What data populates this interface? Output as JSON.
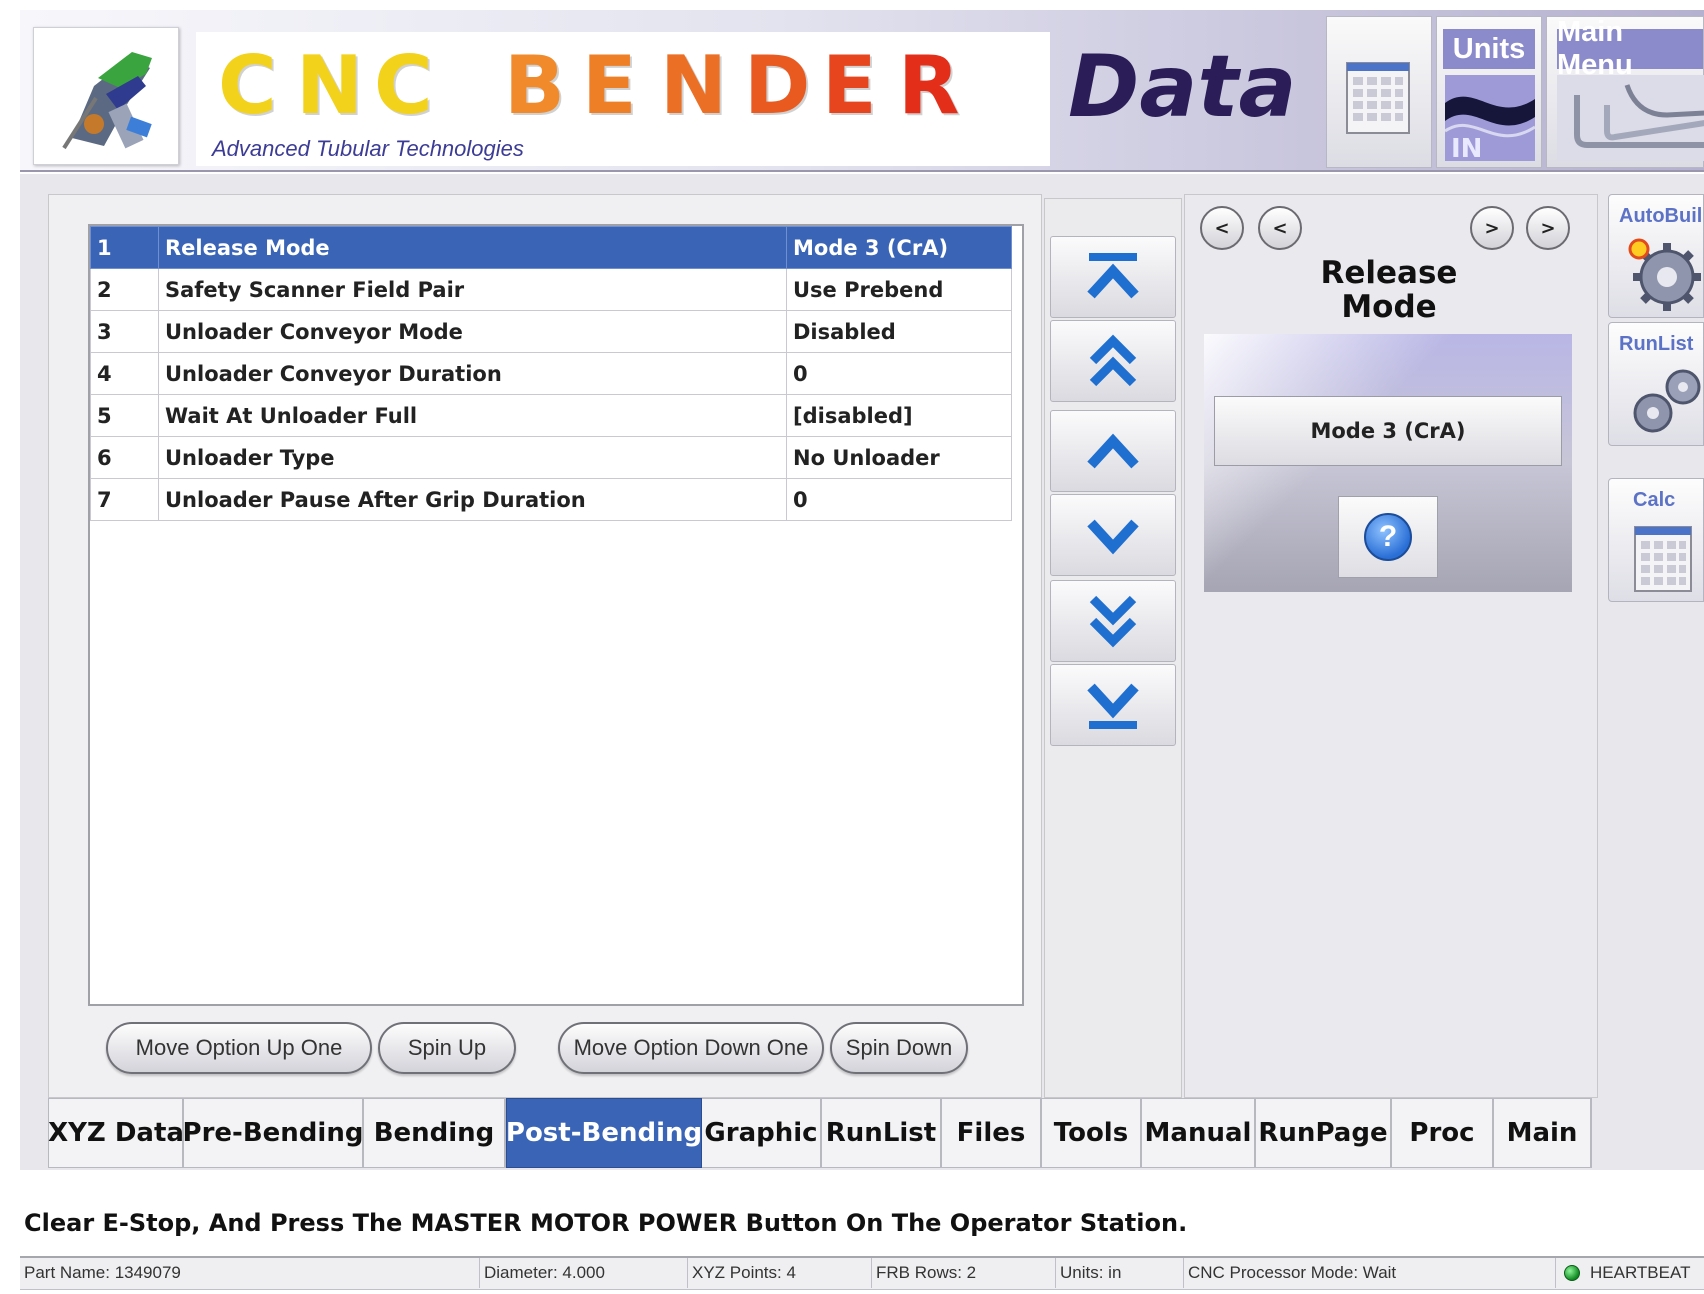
{
  "header": {
    "title_letters": [
      {
        "char": "C",
        "color": "#f2d21a"
      },
      {
        "char": "N",
        "color": "#f2d21a"
      },
      {
        "char": "C",
        "color": "#f2d21a"
      },
      {
        "char": "B",
        "color": "#f08a2a"
      },
      {
        "char": "E",
        "color": "#ee7f27"
      },
      {
        "char": "N",
        "color": "#eb6f24"
      },
      {
        "char": "D",
        "color": "#e85a20"
      },
      {
        "char": "E",
        "color": "#e6451d"
      },
      {
        "char": "R",
        "color": "#e32e1a"
      }
    ],
    "subtitle": "Advanced Tubular Technologies",
    "data_word": "Data",
    "calc_icon": "calculator-icon",
    "units_label": "Units",
    "units_badge": "IN",
    "main_menu_label": "Main Menu"
  },
  "options": {
    "rows": [
      {
        "num": "1",
        "name": "Release Mode",
        "value": "Mode 3 (CrA)"
      },
      {
        "num": "2",
        "name": "Safety Scanner Field Pair",
        "value": "Use Prebend"
      },
      {
        "num": "3",
        "name": "Unloader Conveyor Mode",
        "value": "Disabled"
      },
      {
        "num": "4",
        "name": "Unloader Conveyor Duration",
        "value": "0"
      },
      {
        "num": "5",
        "name": "Wait At Unloader Full",
        "value": "[disabled]"
      },
      {
        "num": "6",
        "name": "Unloader Type",
        "value": "No Unloader"
      },
      {
        "num": "7",
        "name": "Unloader Pause After Grip Duration",
        "value": "0"
      }
    ],
    "selected_index": 0
  },
  "buttons": {
    "move_up": "Move Option Up One",
    "spin_up": "Spin Up",
    "move_down": "Move Option Down One",
    "spin_down": "Spin Down"
  },
  "nav_icons": [
    "first-icon",
    "page-up-icon",
    "up-icon",
    "down-icon",
    "page-down-icon",
    "last-icon"
  ],
  "property": {
    "nav_left_1": "<",
    "nav_left_2": "<",
    "nav_right_1": ">",
    "nav_right_2": ">",
    "title_line1": "Release",
    "title_line2": "Mode",
    "value": "Mode 3 (CrA)",
    "help": "?"
  },
  "side": {
    "autobuild": "AutoBuild",
    "runlist": "RunList",
    "calc": "Calc"
  },
  "tabs": [
    {
      "label": "XYZ Data",
      "active": false
    },
    {
      "label": "Pre-Bending",
      "active": false
    },
    {
      "label": "Bending",
      "active": false
    },
    {
      "label": "Post-Bending",
      "active": true
    },
    {
      "label": "Graphic",
      "active": false
    },
    {
      "label": "RunList",
      "active": false
    },
    {
      "label": "Files",
      "active": false
    },
    {
      "label": "Tools",
      "active": false
    },
    {
      "label": "Manual",
      "active": false
    },
    {
      "label": "RunPage",
      "active": false
    },
    {
      "label": "Proc",
      "active": false
    },
    {
      "label": "Main",
      "active": false
    }
  ],
  "message": "Clear E-Stop, And Press The MASTER MOTOR POWER Button On The Operator Station.",
  "status": {
    "part_name": "Part Name: 1349079",
    "diameter": "Diameter: 4.000",
    "xyz_points": "XYZ Points: 4",
    "frb_rows": "FRB Rows: 2",
    "units": "Units: in",
    "cnc_mode": "CNC Processor Mode: Wait",
    "heartbeat": "HEARTBEAT"
  },
  "colors": {
    "accent": "#3a64b5",
    "nav_arrow": "#1f6fd1",
    "heartbeat": "#1a9a2e"
  }
}
